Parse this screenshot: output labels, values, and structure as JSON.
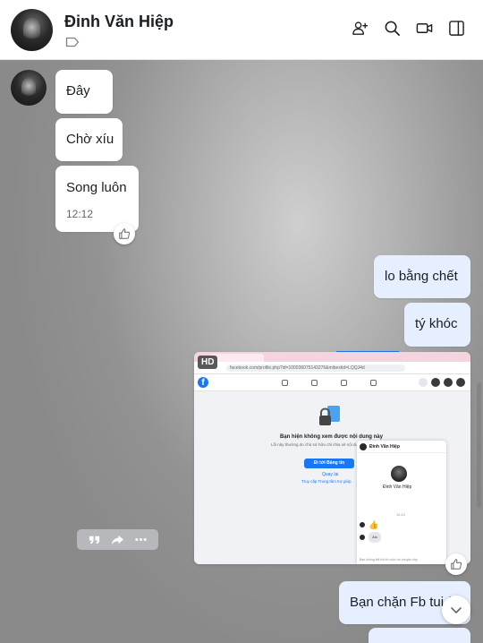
{
  "header": {
    "contact_name": "Đinh Văn Hiệp",
    "icons": [
      "add-member-icon",
      "search-icon",
      "video-call-icon",
      "toggle-sidebar-icon"
    ]
  },
  "messages": {
    "incoming": [
      {
        "text": "Đây"
      },
      {
        "text": "Chờ xíu"
      },
      {
        "text": "Song luôn",
        "time": "12:12"
      }
    ],
    "outgoing": [
      {
        "text": "lo bằng chết"
      },
      {
        "text": "tý khóc"
      },
      {
        "text": "Bạn chặn Fb tui à"
      }
    ]
  },
  "image_attachment": {
    "badge": "HD",
    "screenshot": {
      "url_text": "facebook.com/profile.php?id=100036075143276&mibextid=LQQJ4d",
      "title": "Bạn hiện không xem được nội dung này",
      "subtitle": "Lỗi này thường do chủ sở hữu chỉ chia sẻ nội dung với một nhóm nhỏ, thay đổi người được xem hoặc đã xóa nội dung.",
      "button": "Đi tới Bảng tin",
      "back_link": "Quay lại",
      "help_link": "Truy cập Trung tâm trợ giúp",
      "chat_name": "Đinh Văn Hiệp",
      "chat_time": "12:12",
      "chat_bubble": "Alo",
      "chat_footer": "Bạn không thể trả lời cuộc trò chuyện này"
    }
  },
  "colors": {
    "outgoing_bubble": "#e5efff",
    "incoming_bubble": "#ffffff",
    "facebook_blue": "#1877f2"
  }
}
